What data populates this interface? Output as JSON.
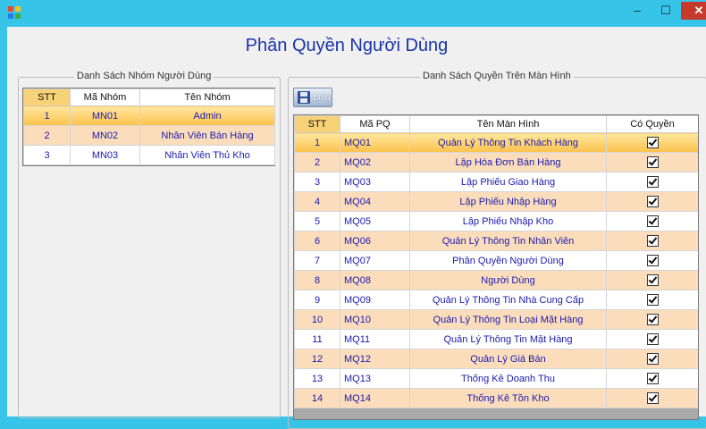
{
  "window": {
    "min": "–",
    "max": "☐",
    "close": "✕"
  },
  "title": "Phân Quyền Người Dùng",
  "groups_panel": {
    "legend": "Danh Sách Nhóm Người Dùng",
    "headers": [
      "STT",
      "Mã Nhóm",
      "Tên Nhóm"
    ],
    "rows": [
      [
        "1",
        "MN01",
        "Admin"
      ],
      [
        "2",
        "MN02",
        "Nhân Viên Bán Hàng"
      ],
      [
        "3",
        "MN03",
        "Nhân Viên Thủ Kho"
      ]
    ]
  },
  "perm_panel": {
    "legend": "Danh Sách Quyền Trên Màn Hình",
    "save_label": "Lưu",
    "headers": [
      "STT",
      "Mã PQ",
      "Tên Màn Hình",
      "Có Quyền"
    ],
    "rows": [
      [
        "1",
        "MQ01",
        "Quản Lý Thông Tin Khách Hàng"
      ],
      [
        "2",
        "MQ02",
        "Lập Hóa Đơn Bán Hàng"
      ],
      [
        "3",
        "MQ03",
        "Lập Phiếu Giao Hàng"
      ],
      [
        "4",
        "MQ04",
        "Lập Phiếu Nhập Hàng"
      ],
      [
        "5",
        "MQ05",
        "Lập Phiếu Nhập Kho"
      ],
      [
        "6",
        "MQ06",
        "Quản Lý Thông Tin Nhân Viên"
      ],
      [
        "7",
        "MQ07",
        "Phân Quyền Người Dùng"
      ],
      [
        "8",
        "MQ08",
        "Người Dùng"
      ],
      [
        "9",
        "MQ09",
        "Quản Lý Thông Tin Nhà Cung Cấp"
      ],
      [
        "10",
        "MQ10",
        "Quản Lý Thông Tin Loại Mặt Hàng"
      ],
      [
        "11",
        "MQ11",
        "Quản Lý Thông Tin Mặt Hàng"
      ],
      [
        "12",
        "MQ12",
        "Quản Lý Giá Bán"
      ],
      [
        "13",
        "MQ13",
        "Thống Kê Doanh Thu"
      ],
      [
        "14",
        "MQ14",
        "Thống Kê Tồn Kho"
      ]
    ],
    "checked": [
      true,
      true,
      true,
      true,
      true,
      true,
      true,
      true,
      true,
      true,
      true,
      true,
      true,
      true
    ]
  },
  "colors": {
    "title": "#1a33a8",
    "alt_row": "#fbdcbb",
    "selected_row": "#fcc24c",
    "cell_text": "#1b1bb0"
  }
}
